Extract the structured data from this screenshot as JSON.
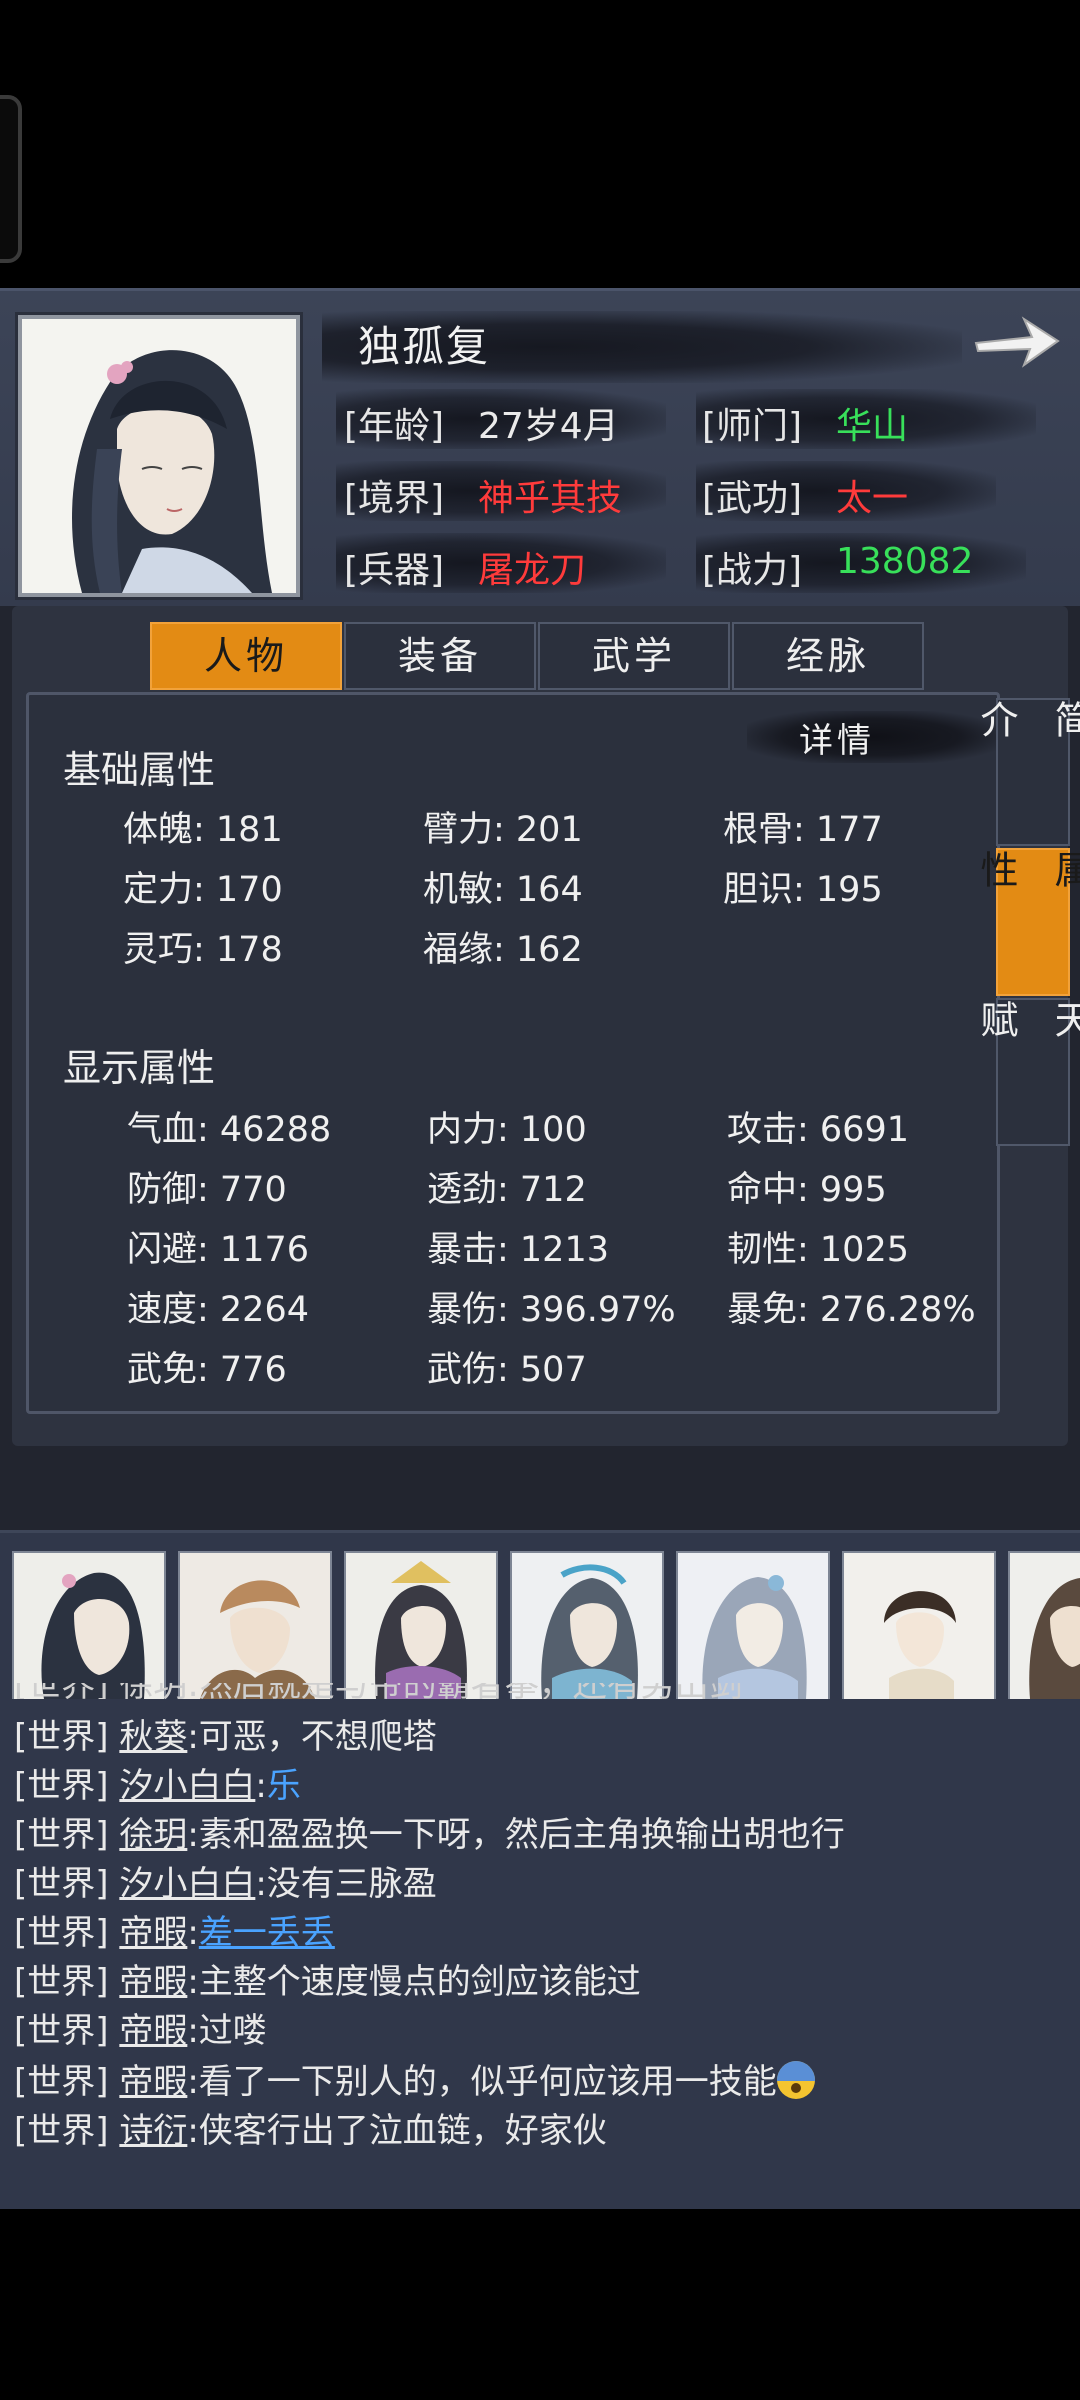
{
  "character": {
    "name": "独孤复",
    "info": [
      {
        "label": "[年龄]",
        "value": "27岁4月",
        "color": "#eaeaea"
      },
      {
        "label": "[师门]",
        "value": "华山",
        "color": "#38e05a"
      },
      {
        "label": "[境界]",
        "value": "神乎其技",
        "color": "#ff3b3b"
      },
      {
        "label": "[武功]",
        "value": "太一",
        "color": "#ff3b3b"
      },
      {
        "label": "[兵器]",
        "value": "屠龙刀",
        "color": "#ff3b3b"
      },
      {
        "label": "[战力]",
        "value": "138082",
        "color": "#38e05a"
      }
    ]
  },
  "tabs": [
    "人物",
    "装备",
    "武学",
    "经脉"
  ],
  "active_tab": "人物",
  "side_tabs": [
    {
      "label": "简介",
      "active": false
    },
    {
      "label": "属性",
      "active": true
    },
    {
      "label": "天赋",
      "active": false
    }
  ],
  "detail_label": "详情",
  "base_section": {
    "title": "基础属性",
    "stats": [
      "体魄: 181",
      "臂力: 201",
      "根骨: 177",
      "定力: 170",
      "机敏: 164",
      "胆识: 195",
      "灵巧: 178",
      "福缘: 162"
    ]
  },
  "display_section": {
    "title": "显示属性",
    "stats": [
      "气血: 46288",
      "内力: 100",
      "攻击: 6691",
      "防御: 770",
      "透劲: 712",
      "命中: 995",
      "闪避: 1176",
      "暴击: 1213",
      "韧性: 1025",
      "速度: 2264",
      "暴伤: 396.97%",
      "暴免: 276.28%",
      "武免: 776",
      "武伤: 507"
    ]
  },
  "chat": {
    "partial_line": "[世界] 徐玥:然后就是与帝的霸者拳，还有男出剑",
    "lines": [
      {
        "channel": "[世界]",
        "user": "秋葵",
        "message": ":可恶，不想爬塔",
        "style": "plain"
      },
      {
        "channel": "[世界]",
        "user": "汐小白白",
        "message": "乐",
        "style": "blue"
      },
      {
        "channel": "[世界]",
        "user": "徐玥",
        "message": ":素和盈盈换一下呀，然后主角换输出胡也行",
        "style": "plain"
      },
      {
        "channel": "[世界]",
        "user": "汐小白白",
        "message": ":没有三脉盈",
        "style": "plain"
      },
      {
        "channel": "[世界]",
        "user": "帝暇",
        "message": "差一丢丢",
        "style": "link"
      },
      {
        "channel": "[世界]",
        "user": "帝暇",
        "message": ":主整个速度慢点的剑应该能过",
        "style": "plain"
      },
      {
        "channel": "[世界]",
        "user": "帝暇",
        "message": ":过喽",
        "style": "plain"
      },
      {
        "channel": "[世界]",
        "user": "帝暇",
        "message": ":看了一下别人的，似乎何应该用一技能",
        "style": "emoji"
      },
      {
        "channel": "[世界]",
        "user": "诗衍",
        "message": ":侠客行出了泣血链，好家伙",
        "style": "plain"
      }
    ]
  },
  "icons": {
    "next": "arrow-right-icon",
    "emoji": "anxious-face-emoji"
  },
  "colors": {
    "accent": "#e38b14",
    "red": "#ff3b3b",
    "green": "#38e05a",
    "link": "#4aa3ff"
  }
}
